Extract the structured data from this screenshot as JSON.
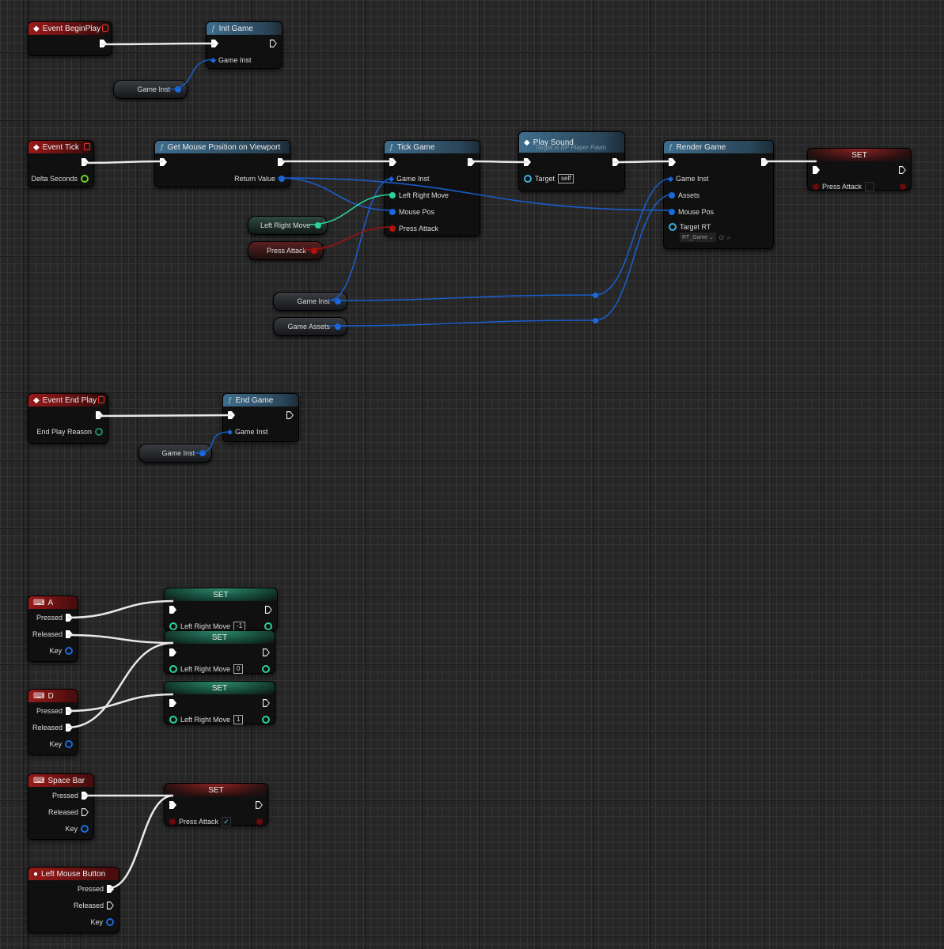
{
  "colors": {
    "exec": "#ffffff",
    "object": "#1a6ae0",
    "float": "#2cd39a",
    "bool": "#b80f0f",
    "event": "#9a1a1a",
    "function": "#3f6d8c"
  },
  "nodes": [
    {
      "id": "begin-play",
      "kind": "event",
      "icon": "event-diamond-icon",
      "title": "Event BeginPlay",
      "rows": [
        {
          "r": {
            "t": "exec"
          }
        }
      ]
    },
    {
      "id": "init-game",
      "kind": "func",
      "icon": "function-icon",
      "title": "Init Game",
      "rows": [
        {
          "l": {
            "t": "exec"
          },
          "r": {
            "t": "exec",
            "hollow": true
          }
        },
        {
          "l": {
            "t": "diamond",
            "label": "Game Inst"
          }
        }
      ]
    },
    {
      "id": "event-tick",
      "kind": "event",
      "icon": "event-diamond-icon",
      "title": "Event Tick",
      "rows": [
        {
          "r": {
            "t": "exec"
          }
        },
        {
          "r": {
            "t": "ring",
            "c": "#6fcf2a",
            "label": "Delta Seconds"
          }
        }
      ]
    },
    {
      "id": "get-mouse-position",
      "kind": "func",
      "icon": "function-icon",
      "title": "Get Mouse Position on Viewport",
      "rows": [
        {
          "l": {
            "t": "exec"
          },
          "r": {
            "t": "exec"
          }
        },
        {
          "r": {
            "t": "dot",
            "c": "#1a6ae0",
            "label": "Return Value"
          }
        }
      ]
    },
    {
      "id": "tick-game",
      "kind": "func",
      "icon": "function-icon",
      "title": "Tick Game",
      "rows": [
        {
          "l": {
            "t": "exec"
          },
          "r": {
            "t": "exec"
          }
        },
        {
          "l": {
            "t": "diamond",
            "label": "Game Inst"
          }
        },
        {
          "l": {
            "t": "dot",
            "c": "#2cd39a",
            "label": "Left Right Move"
          }
        },
        {
          "l": {
            "t": "dot",
            "c": "#1a6ae0",
            "label": "Mouse Pos"
          }
        },
        {
          "l": {
            "t": "dot",
            "c": "#b80f0f",
            "label": "Press Attack"
          }
        }
      ]
    },
    {
      "id": "play-sound",
      "kind": "func",
      "icon": "event-diamond-icon",
      "title": "Play Sound",
      "subtitle": "Target is BP Player Pawn",
      "rows": [
        {
          "l": {
            "t": "exec"
          },
          "r": {
            "t": "exec"
          }
        },
        {
          "l": {
            "t": "ring",
            "c": "#3ab0e0",
            "label": "Target",
            "value": "self"
          }
        }
      ]
    },
    {
      "id": "render-game",
      "kind": "func",
      "icon": "function-icon",
      "title": "Render Game",
      "rows": [
        {
          "l": {
            "t": "exec"
          },
          "r": {
            "t": "exec"
          }
        },
        {
          "l": {
            "t": "diamond",
            "label": "Game Inst"
          }
        },
        {
          "l": {
            "t": "dot",
            "c": "#1a6ae0",
            "label": "Assets"
          }
        },
        {
          "l": {
            "t": "dot",
            "c": "#1a6ae0",
            "label": "Mouse Pos"
          }
        },
        {
          "l": {
            "t": "ring",
            "c": "#3ab0e0",
            "label": "Target RT",
            "dropdown": "RT_Game"
          }
        }
      ]
    },
    {
      "id": "set-press-attack-1",
      "kind": "set-red",
      "title": "SET",
      "rows": [
        {
          "l": {
            "t": "exec"
          },
          "r": {
            "t": "exec",
            "hollow": true
          }
        },
        {
          "l": {
            "t": "dot",
            "c": "#6a0a0a",
            "label": "Press Attack",
            "check": ""
          },
          "r": {
            "t": "dot",
            "c": "#6a0a0a"
          }
        }
      ]
    },
    {
      "id": "event-end-play",
      "kind": "event",
      "icon": "event-diamond-icon",
      "title": "Event End Play",
      "rows": [
        {
          "r": {
            "t": "exec"
          }
        },
        {
          "r": {
            "t": "ring",
            "c": "#1a8a6a",
            "label": "End Play Reason"
          }
        }
      ]
    },
    {
      "id": "end-game",
      "kind": "func",
      "icon": "function-icon",
      "title": "End Game",
      "rows": [
        {
          "l": {
            "t": "exec"
          },
          "r": {
            "t": "exec",
            "hollow": true
          }
        },
        {
          "l": {
            "t": "diamond",
            "label": "Game Inst"
          }
        }
      ]
    },
    {
      "id": "key-a",
      "kind": "key",
      "icon": "keyboard-icon",
      "title": "A",
      "rows": [
        {
          "r": {
            "t": "exec",
            "label": "Pressed"
          }
        },
        {
          "r": {
            "t": "exec",
            "label": "Released"
          }
        },
        {
          "r": {
            "t": "ring",
            "c": "#1a6ae0",
            "label": "Key"
          }
        }
      ]
    },
    {
      "id": "set-lrm-neg1",
      "kind": "set-green",
      "title": "SET",
      "rows": [
        {
          "l": {
            "t": "exec"
          },
          "r": {
            "t": "exec",
            "hollow": true
          }
        },
        {
          "l": {
            "t": "ring",
            "c": "#2cd39a",
            "label": "Left Right Move",
            "value": "-1"
          },
          "r": {
            "t": "ring",
            "c": "#2cd39a"
          }
        }
      ]
    },
    {
      "id": "set-lrm-0",
      "kind": "set-green",
      "title": "SET",
      "rows": [
        {
          "l": {
            "t": "exec"
          },
          "r": {
            "t": "exec",
            "hollow": true
          }
        },
        {
          "l": {
            "t": "ring",
            "c": "#2cd39a",
            "label": "Left Right Move",
            "value": "0"
          },
          "r": {
            "t": "ring",
            "c": "#2cd39a"
          }
        }
      ]
    },
    {
      "id": "key-d",
      "kind": "key",
      "icon": "keyboard-icon",
      "title": "D",
      "rows": [
        {
          "r": {
            "t": "exec",
            "label": "Pressed"
          }
        },
        {
          "r": {
            "t": "exec",
            "label": "Released"
          }
        },
        {
          "r": {
            "t": "ring",
            "c": "#1a6ae0",
            "label": "Key"
          }
        }
      ]
    },
    {
      "id": "set-lrm-1",
      "kind": "set-green",
      "title": "SET",
      "rows": [
        {
          "l": {
            "t": "exec"
          },
          "r": {
            "t": "exec",
            "hollow": true
          }
        },
        {
          "l": {
            "t": "ring",
            "c": "#2cd39a",
            "label": "Left Right Move",
            "value": "1"
          },
          "r": {
            "t": "ring",
            "c": "#2cd39a"
          }
        }
      ]
    },
    {
      "id": "key-space",
      "kind": "key",
      "icon": "keyboard-icon",
      "title": "Space Bar",
      "rows": [
        {
          "r": {
            "t": "exec",
            "label": "Pressed"
          }
        },
        {
          "r": {
            "t": "exec",
            "label": "Released",
            "hollow": true
          }
        },
        {
          "r": {
            "t": "ring",
            "c": "#1a6ae0",
            "label": "Key"
          }
        }
      ]
    },
    {
      "id": "set-press-attack-2",
      "kind": "set-red",
      "title": "SET",
      "rows": [
        {
          "l": {
            "t": "exec"
          },
          "r": {
            "t": "exec",
            "hollow": true
          }
        },
        {
          "l": {
            "t": "dot",
            "c": "#6a0a0a",
            "label": "Press Attack",
            "check": "✓"
          },
          "r": {
            "t": "dot",
            "c": "#6a0a0a"
          }
        }
      ]
    },
    {
      "id": "left-mouse-button",
      "kind": "key",
      "icon": "mouse-icon",
      "title": "Left Mouse Button",
      "rows": [
        {
          "r": {
            "t": "exec",
            "label": "Pressed"
          }
        },
        {
          "r": {
            "t": "exec",
            "label": "Released",
            "hollow": true
          }
        },
        {
          "r": {
            "t": "ring",
            "c": "#1a6ae0",
            "label": "Key"
          }
        }
      ]
    }
  ],
  "variables": [
    {
      "id": "var-game-inst-1",
      "label": "Game Inst",
      "type": "object"
    },
    {
      "id": "var-left-right-move",
      "label": "Left Right Move",
      "type": "float"
    },
    {
      "id": "var-press-attack",
      "label": "Press Attack",
      "type": "bool"
    },
    {
      "id": "var-game-inst-2",
      "label": "Game Inst",
      "type": "object"
    },
    {
      "id": "var-game-assets",
      "label": "Game Assets",
      "type": "object"
    },
    {
      "id": "var-game-inst-3",
      "label": "Game Inst",
      "type": "object"
    }
  ]
}
